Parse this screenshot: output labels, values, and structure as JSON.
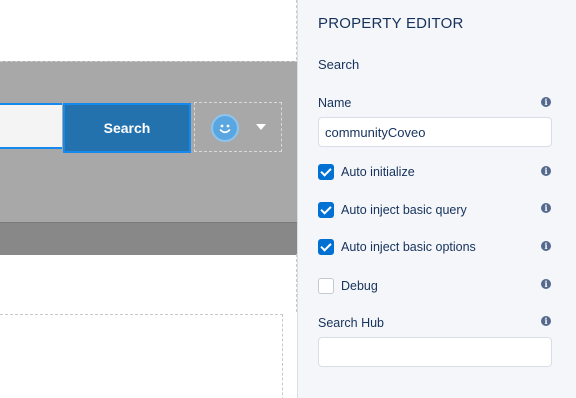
{
  "canvas": {
    "search_button_label": "Search"
  },
  "panel": {
    "title": "PROPERTY EDITOR",
    "section": "Search",
    "name_label": "Name",
    "name_value": "communityCoveo",
    "checkboxes": [
      {
        "label": "Auto initialize",
        "checked": true
      },
      {
        "label": "Auto inject basic query",
        "checked": true
      },
      {
        "label": "Auto inject basic options",
        "checked": true
      },
      {
        "label": "Debug",
        "checked": false
      }
    ],
    "search_hub_label": "Search Hub",
    "search_hub_value": ""
  },
  "colors": {
    "accent": "#0070d2",
    "search_button": "#2472ad",
    "banner": "#a8a8a8",
    "panel_bg": "#f4f6f9"
  },
  "icons": {
    "info": "info-icon",
    "avatar": "smiley-avatar-icon",
    "menu": "chevron-down-icon",
    "check": "checkmark-icon"
  }
}
